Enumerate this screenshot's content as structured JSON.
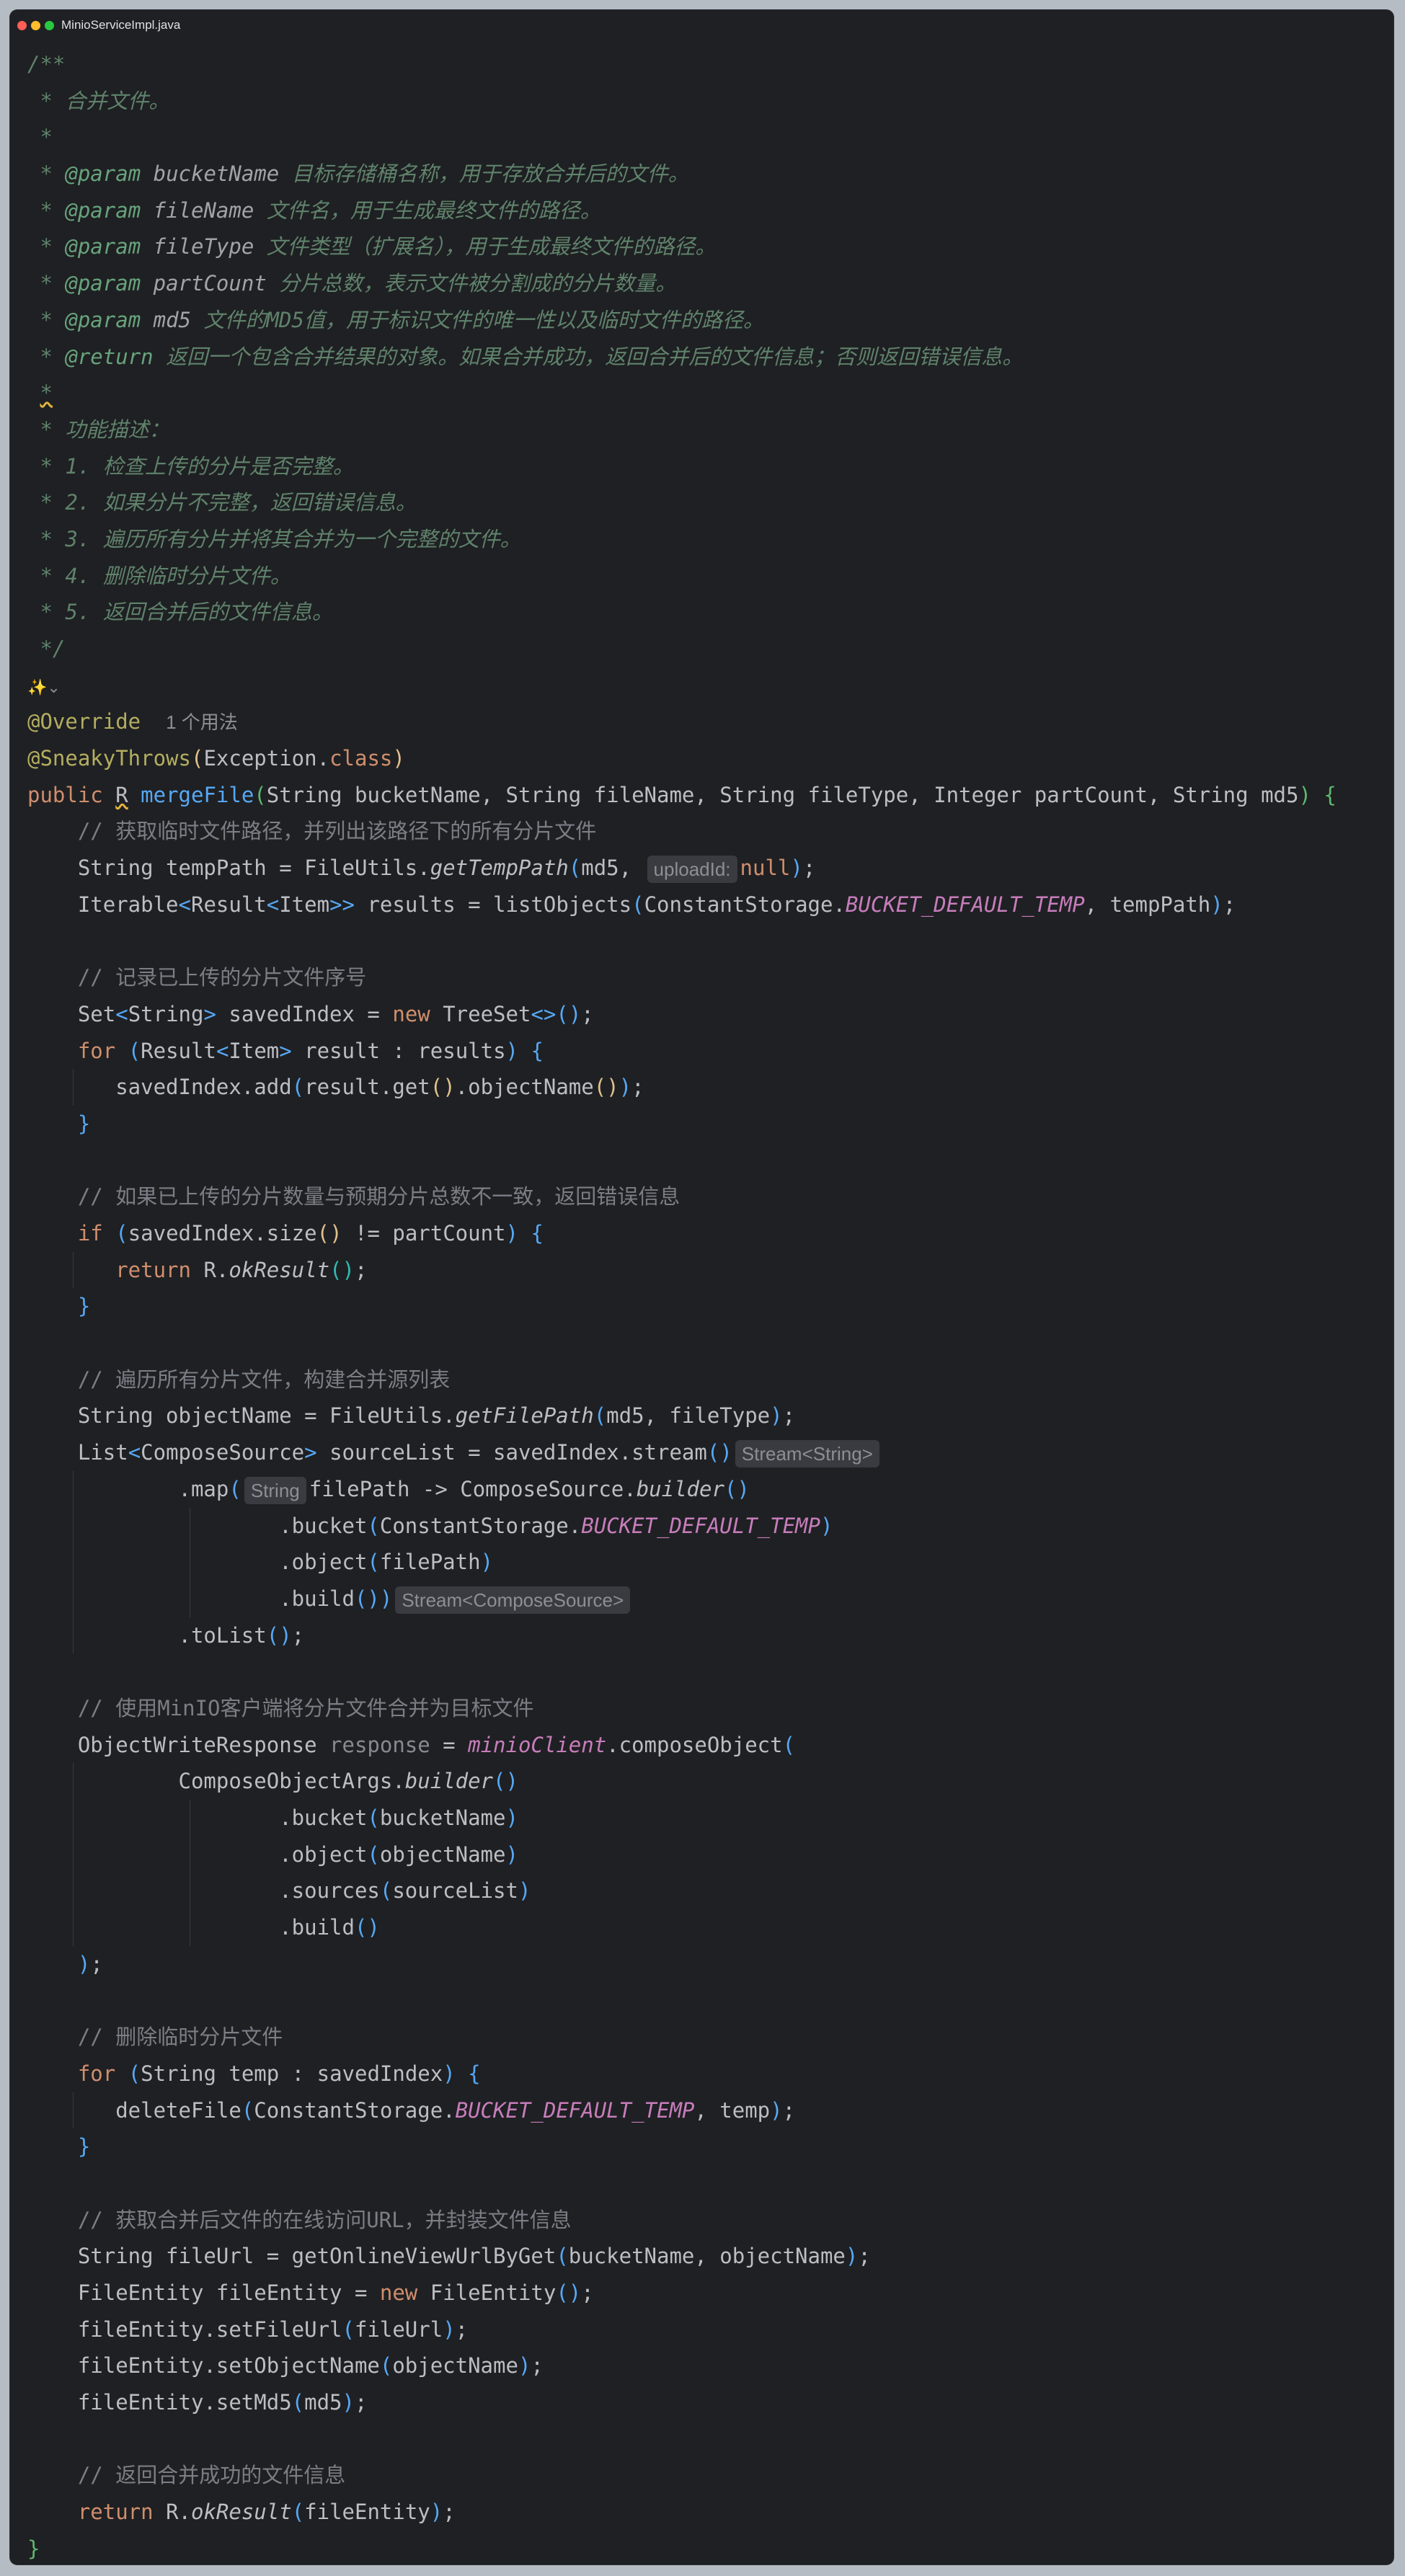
{
  "window": {
    "file_name": "MinioServiceImpl.java"
  },
  "editor": {
    "doc": {
      "open": "/**",
      "summary": " * 合并文件。",
      "blank": " *",
      "p1_name": "bucketName",
      "p1_desc": "目标存储桶名称，用于存放合并后的文件。",
      "p2_name": "fileName",
      "p2_desc": "文件名，用于生成最终文件的路径。",
      "p3_name": "fileType",
      "p3_desc": "文件类型（扩展名），用于生成最终文件的路径。",
      "p4_name": "partCount",
      "p4_desc": "分片总数，表示文件被分割成的分片数量。",
      "p5_name": "md5",
      "p5_desc": "文件的MD5值，用于标识文件的唯一性以及临时文件的路径。",
      "return_desc": "返回一个包含合并结果的对象。如果合并成功，返回合并后的文件信息；否则返回错误信息。",
      "feature_title": " * 功能描述：",
      "f1": " * 1. 检查上传的分片是否完整。",
      "f2": " * 2. 如果分片不完整，返回错误信息。",
      "f3": " * 3. 遍历所有分片并将其合并为一个完整的文件。",
      "f4": " * 4. 删除临时分片文件。",
      "f5": " * 5. 返回合并后的文件信息。",
      "close": " */"
    },
    "usage_hint": "1 个用法",
    "inlay": {
      "upload_id": "uploadId:",
      "stream_string": "Stream<String>",
      "string": "String",
      "stream_compose": "Stream<ComposeSource>"
    },
    "comments": {
      "c1": "// 获取临时文件路径，并列出该路径下的所有分片文件",
      "c2": "// 记录已上传的分片文件序号",
      "c3": "// 如果已上传的分片数量与预期分片总数不一致，返回错误信息",
      "c4": "// 遍历所有分片文件，构建合并源列表",
      "c5": "// 使用MinIO客户端将分片文件合并为目标文件",
      "c6": "// 删除临时分片文件",
      "c7": "// 获取合并后文件的在线访问URL，并封装文件信息",
      "c8": "// 返回合并成功的文件信息"
    },
    "icons": {
      "ai_assistant": "ai-sparkle-icon"
    },
    "colors": {
      "background": "#1f2023",
      "keyword": "#cf8e6d",
      "function": "#56a8f5",
      "constant": "#c77dbb",
      "doc_comment": "#5f826b"
    }
  }
}
